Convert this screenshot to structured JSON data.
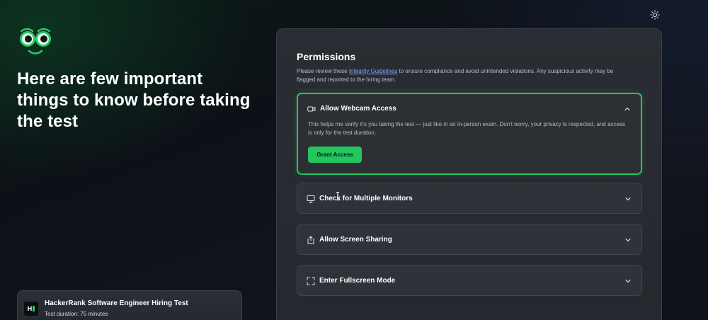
{
  "headline": "Here are few important things to know before taking the test",
  "test_card": {
    "logo_text": "H",
    "title": "HackerRank Software Engineer Hiring Test",
    "duration": "Test duration: 75 minutes"
  },
  "permissions": {
    "title": "Permissions",
    "desc_before": "Please review these ",
    "desc_link": "Integrity Guidelines",
    "desc_after": " to ensure compliance and avoid unintended violations. Any suspicious activity may be flagged and reported to the hiring team.",
    "items": [
      {
        "label": "Allow Webcam Access",
        "icon": "webcam-icon",
        "expanded": true,
        "body": "This helps me verify it's you taking the test — just like in an in-person exam. Don't worry, your privacy is respected, and access is only for the test duration.",
        "button": "Grant Access"
      },
      {
        "label": "Check for Multiple Monitors",
        "icon": "monitor-icon",
        "expanded": false
      },
      {
        "label": "Allow Screen Sharing",
        "icon": "share-icon",
        "expanded": false
      },
      {
        "label": "Enter Fullscreen Mode",
        "icon": "fullscreen-icon",
        "expanded": false
      }
    ]
  },
  "colors": {
    "accent": "#22c55e",
    "link": "#7aa7ff",
    "panel": "#2a2d33"
  }
}
